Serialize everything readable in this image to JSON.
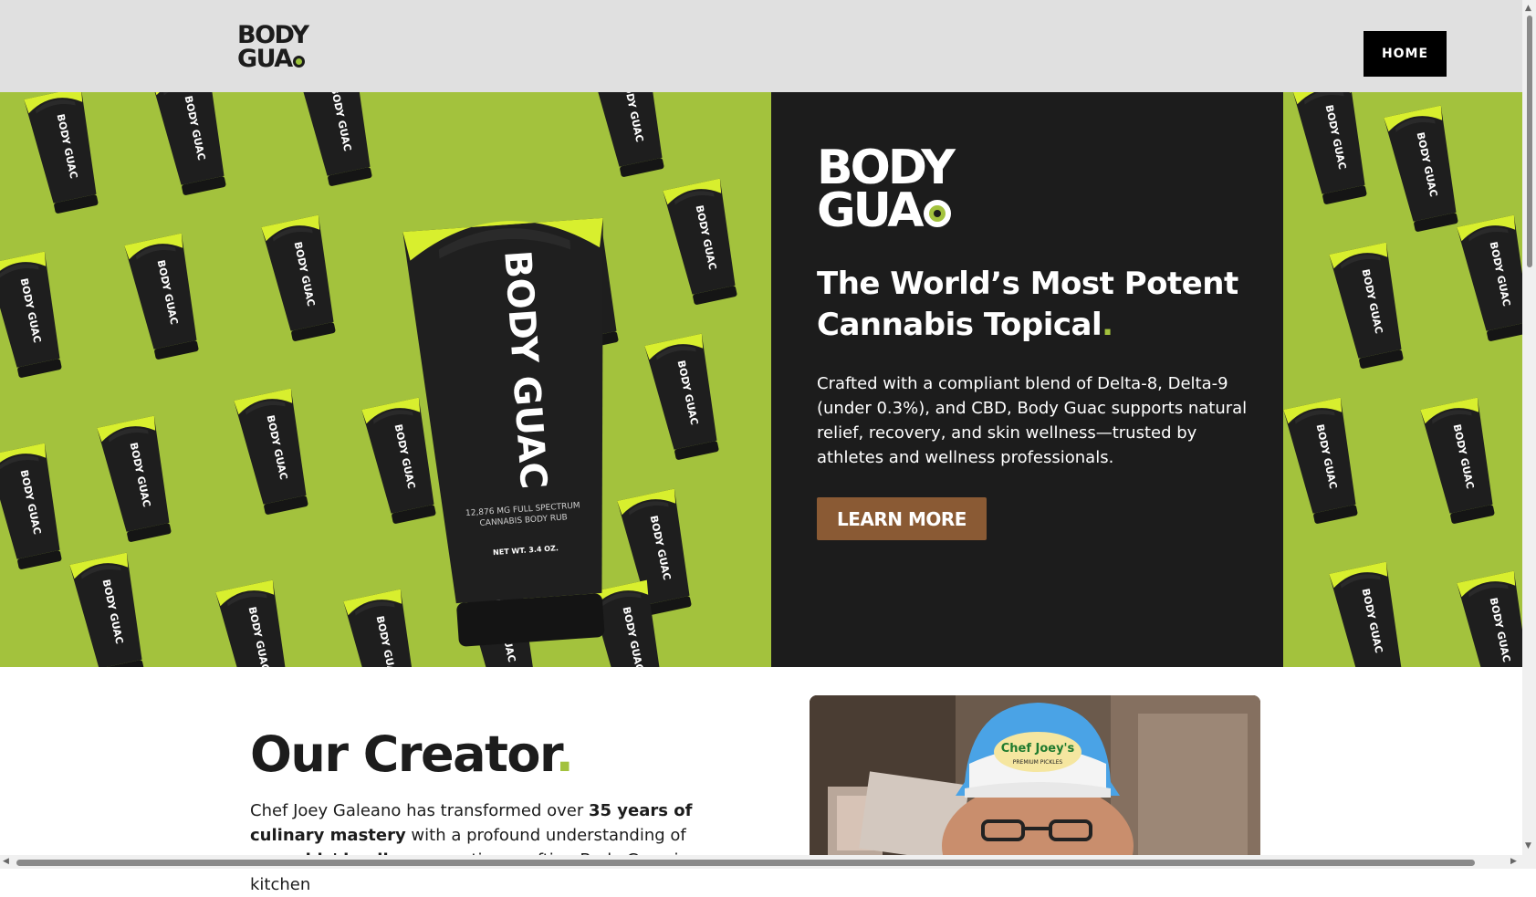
{
  "header": {
    "logo_line1": "BODY",
    "logo_line2": "GUA",
    "home_label": "HOME"
  },
  "hero": {
    "logo_line1": "BODY",
    "logo_line2": "GUA",
    "title": "The World’s Most Potent Cannabis Topical",
    "title_dot": ".",
    "description": "Crafted with a compliant blend of Delta-8, Delta-9 (under 0.3%), and CBD, Body Guac supports natural relief, recovery, and skin wellness—trusted by athletes and wellness professionals.",
    "cta_label": "LEARN MORE",
    "product": {
      "brand": "BODY GUAC",
      "line1": "12,876 MG FULL SPECTRUM",
      "line2": "CANNABIS BODY RUB",
      "net_wt": "NET WT. 3.4 OZ."
    }
  },
  "creator": {
    "title": "Our Creator",
    "title_dot": ".",
    "text_part1": "Chef Joey Galeano has transformed over ",
    "text_bold1": "35 years of culinary mastery",
    "text_part2": " with a profound understanding of ",
    "text_bold2": "cannabis' healing",
    "text_part3": " properties, crafting Body Guac in a kitchen",
    "hat_text_1": "Chef Joey's",
    "hat_text_2": "PREMIUM PICKLES"
  },
  "colors": {
    "accent_green": "#a3c23d",
    "panel_dark": "#1c1c1c",
    "cta_brown": "#8a5a34",
    "header_gray": "#e0e0e0"
  }
}
